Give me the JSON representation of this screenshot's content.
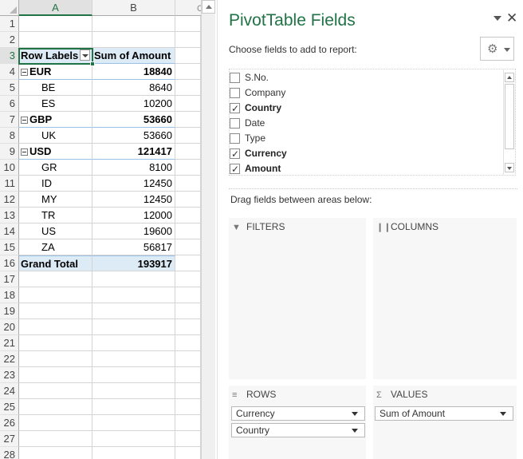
{
  "sheet": {
    "columns": [
      "A",
      "B",
      "C"
    ],
    "row_numbers": [
      "1",
      "2",
      "3",
      "4",
      "5",
      "6",
      "7",
      "8",
      "9",
      "10",
      "11",
      "12",
      "13",
      "14",
      "15",
      "16",
      "17",
      "18",
      "19",
      "20",
      "21",
      "22",
      "23",
      "24",
      "25",
      "26",
      "27",
      "28"
    ],
    "pivot": {
      "row_labels_header": "Row Labels",
      "sum_header": "Sum of Amount",
      "rows": [
        {
          "label": "EUR",
          "value": "18840",
          "group": true
        },
        {
          "label": "BE",
          "value": "8640",
          "group": false
        },
        {
          "label": "ES",
          "value": "10200",
          "group": false
        },
        {
          "label": "GBP",
          "value": "53660",
          "group": true
        },
        {
          "label": "UK",
          "value": "53660",
          "group": false
        },
        {
          "label": "USD",
          "value": "121417",
          "group": true
        },
        {
          "label": "GR",
          "value": "8100",
          "group": false
        },
        {
          "label": "ID",
          "value": "12450",
          "group": false
        },
        {
          "label": "MY",
          "value": "12450",
          "group": false
        },
        {
          "label": "TR",
          "value": "12000",
          "group": false
        },
        {
          "label": "US",
          "value": "19600",
          "group": false
        },
        {
          "label": "ZA",
          "value": "56817",
          "group": false
        }
      ],
      "grand_total_label": "Grand Total",
      "grand_total_value": "193917"
    }
  },
  "pane": {
    "title": "PivotTable Fields",
    "choose_label": "Choose fields to add to report:",
    "gear_icon": "gear-icon",
    "fields": [
      {
        "label": "S.No.",
        "checked": false
      },
      {
        "label": "Company",
        "checked": false
      },
      {
        "label": "Country",
        "checked": true
      },
      {
        "label": "Date",
        "checked": false
      },
      {
        "label": "Type",
        "checked": false
      },
      {
        "label": "Currency",
        "checked": true
      },
      {
        "label": "Amount",
        "checked": true
      }
    ],
    "drag_label": "Drag fields between areas below:",
    "areas": {
      "filters": {
        "label": "FILTERS",
        "icon": "filter-icon"
      },
      "columns": {
        "label": "COLUMNS",
        "icon": "columns-icon"
      },
      "rows": {
        "label": "ROWS",
        "icon": "rows-icon",
        "items": [
          "Currency",
          "Country"
        ]
      },
      "values": {
        "label": "VALUES",
        "icon": "sigma-icon",
        "items": [
          "Sum of Amount"
        ]
      }
    }
  },
  "colors": {
    "accent": "#217346",
    "pivot_header": "#ddebf7"
  }
}
